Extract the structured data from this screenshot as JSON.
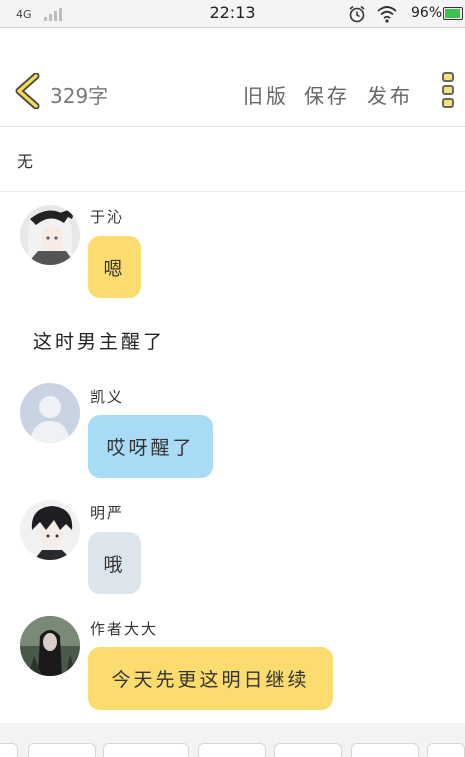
{
  "status_bar": {
    "network": "4G",
    "time": "22:13",
    "battery_percent": "96%",
    "battery_level": 0.96,
    "icons": [
      "signal-icon",
      "alarm-icon",
      "wifi-icon",
      "battery-icon"
    ]
  },
  "header": {
    "char_count": "329字",
    "old_version": "旧版",
    "save": "保存",
    "publish": "发布",
    "icons": [
      "back-chevron-icon",
      "more-menu-icon"
    ]
  },
  "summary": {
    "text": "无"
  },
  "messages": [
    {
      "sender": "于沁",
      "text": "嗯",
      "bubble_color": "#fcdc6e",
      "avatar": "avatar-girl-bow"
    },
    {
      "narration": "这时男主醒了"
    },
    {
      "sender": "凯义",
      "text": "哎呀醒了",
      "bubble_color": "#a8dcf6",
      "avatar": "avatar-default-person"
    },
    {
      "sender": "明严",
      "text": "哦",
      "bubble_color": "#dde5ec",
      "avatar": "avatar-dark-hair-boy"
    },
    {
      "sender": "作者大大",
      "text": "今天先更这明日继续",
      "bubble_color": "#fcdc6e",
      "avatar": "avatar-dark-scene"
    }
  ],
  "colors": {
    "accent_yellow": "#fcdc6e",
    "bubble_blue": "#a8dcf6",
    "bubble_grey": "#dde5ec",
    "battery_green": "#3ac24a"
  }
}
